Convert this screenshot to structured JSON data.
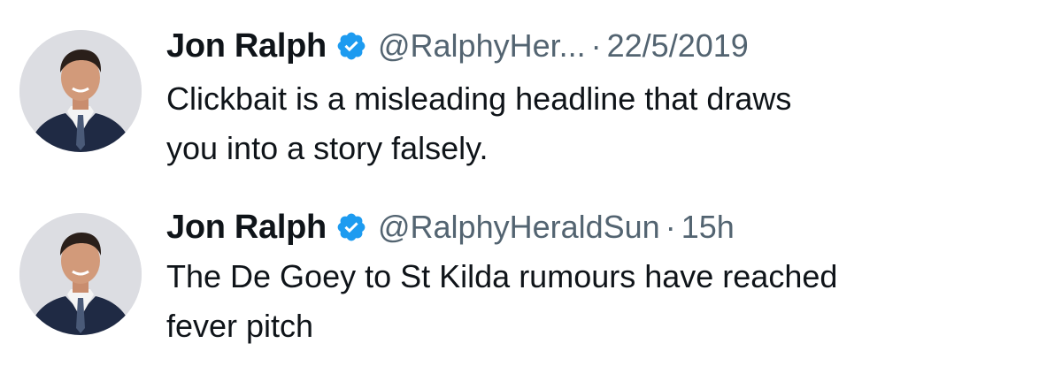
{
  "colors": {
    "text_primary": "#0f1419",
    "text_secondary": "#536471",
    "verified_blue": "#1d9bf0",
    "background": "#ffffff"
  },
  "tweets": [
    {
      "display_name": "Jon Ralph",
      "verified_icon": "verified-badge-icon",
      "handle": "@RalphyHer...",
      "separator": "·",
      "timestamp": "22/5/2019",
      "text_lines": [
        "Clickbait is a misleading headline that draws",
        "you into a story falsely."
      ]
    },
    {
      "display_name": "Jon Ralph",
      "verified_icon": "verified-badge-icon",
      "handle": "@RalphyHeraldSun",
      "separator": "·",
      "timestamp": "15h",
      "text_lines": [
        "The De Goey to St Kilda rumours have reached",
        "fever pitch"
      ]
    }
  ]
}
